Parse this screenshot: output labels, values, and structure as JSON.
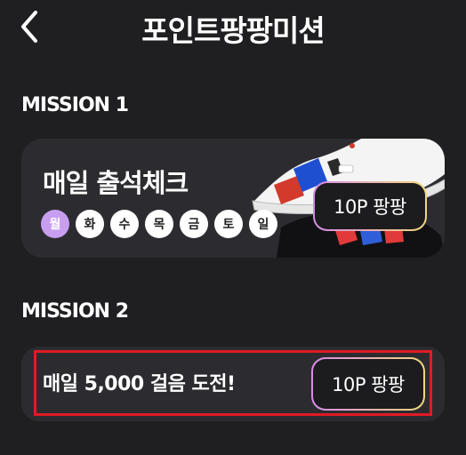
{
  "header": {
    "title": "포인트팡팡미션",
    "back_icon": "chevron-left-icon"
  },
  "mission1": {
    "label": "MISSION 1",
    "title": "매일 출석체크",
    "days": [
      {
        "label": "월",
        "checked": true
      },
      {
        "label": "화",
        "checked": false
      },
      {
        "label": "수",
        "checked": false
      },
      {
        "label": "목",
        "checked": false
      },
      {
        "label": "금",
        "checked": false
      },
      {
        "label": "토",
        "checked": false
      },
      {
        "label": "일",
        "checked": false
      }
    ],
    "reward_label": "10P 팡팡",
    "image": "sneaker-image"
  },
  "mission2": {
    "label": "MISSION 2",
    "title": "매일 5,000 걸음 도전!",
    "reward_label": "10P 팡팡"
  },
  "colors": {
    "background": "#1f1f21",
    "card": "#2c2c30",
    "active_day": "#c89ef0",
    "highlight": "#e01b24",
    "button_gradient_start": "#d98be8",
    "button_gradient_end": "#f2d77a"
  }
}
